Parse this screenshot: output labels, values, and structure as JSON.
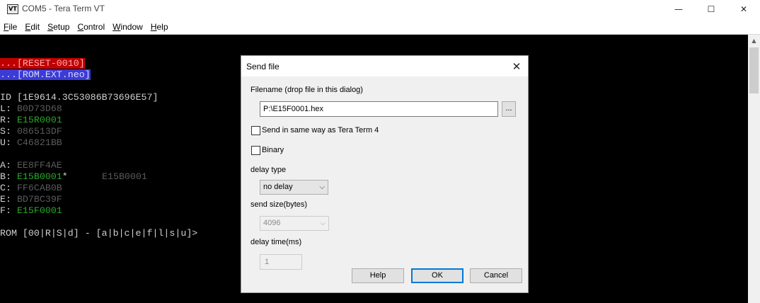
{
  "window": {
    "icon_text": "VT",
    "title": "COM5 - Tera Term VT",
    "minimize": "—",
    "maximize": "☐",
    "close": "✕"
  },
  "menu": [
    {
      "label": "File",
      "accel": "F",
      "rest": "ile"
    },
    {
      "label": "Edit",
      "accel": "E",
      "rest": "dit"
    },
    {
      "label": "Setup",
      "accel": "S",
      "rest": "etup"
    },
    {
      "label": "Control",
      "accel": "C",
      "rest": "ontrol"
    },
    {
      "label": "Window",
      "accel": "W",
      "rest": "indow"
    },
    {
      "label": "Help",
      "accel": "H",
      "rest": "elp"
    }
  ],
  "terminal": {
    "reset_line": "...[RESET-0010]",
    "rom_line": "...[ROM.EXT.neo]",
    "id_line": "ID [1E9614.3C53086B73696E57]",
    "regs1": [
      {
        "key": "L: ",
        "val": "B0D73D68",
        "color": "gray"
      },
      {
        "key": "R: ",
        "val": "E15R0001",
        "color": "green"
      },
      {
        "key": "S: ",
        "val": "086513DF",
        "color": "gray"
      },
      {
        "key": "U: ",
        "val": "C46821BB",
        "color": "gray"
      }
    ],
    "regs2": [
      {
        "key": "A: ",
        "val": "EE8FF4AE",
        "color": "gray"
      },
      {
        "key": "B: ",
        "val": "E15B0001",
        "color": "green"
      },
      {
        "key": "C: ",
        "val": "FF6CAB0B",
        "color": "gray"
      },
      {
        "key": "E: ",
        "val": "BD7BC39F",
        "color": "gray"
      },
      {
        "key": "F: ",
        "val": "E15F0001",
        "color": "green"
      }
    ],
    "b_marker": "*",
    "b_extra": "E15B0001",
    "prompt": "ROM [00|R|S|d] - [a|b|c|e|f|l|s|u]>"
  },
  "scrollbar": {
    "up_arrow": "▲"
  },
  "dialog": {
    "title": "Send file",
    "close": "✕",
    "filename_label": "Filename (drop file in this dialog)",
    "filename_value": "P:\\E15F0001.hex",
    "browse_label": "...",
    "send_same_label": "Send in same way as Tera Term 4",
    "binary_label": "Binary",
    "delay_type_label": "delay type",
    "delay_type_value": "no delay",
    "send_size_label": "send size(bytes)",
    "send_size_value": "4096",
    "delay_time_label": "delay time(ms)",
    "delay_time_value": "1",
    "combo_arrow": "⌵",
    "help_button": "Help",
    "ok_button": "OK",
    "cancel_button": "Cancel"
  },
  "colors": {
    "terminal_bg": "#000000",
    "reset_bg": "#c00000",
    "rom_bg": "#3b3bd6",
    "green": "#29a829",
    "gray": "#5a5a5a",
    "ok_border": "#0078d7"
  }
}
